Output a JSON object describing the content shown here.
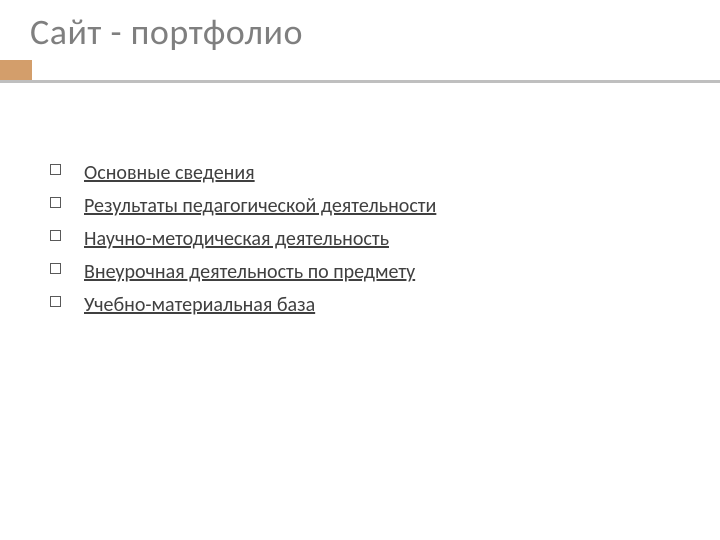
{
  "title": "Сайт - портфолио",
  "items": [
    {
      "label": "Основные сведения"
    },
    {
      "label": "Результаты педагогической деятельности"
    },
    {
      "label": "Научно-методическая деятельность"
    },
    {
      "label": "Внеурочная деятельность по предмету"
    },
    {
      "label": "Учебно-материальная база"
    }
  ]
}
